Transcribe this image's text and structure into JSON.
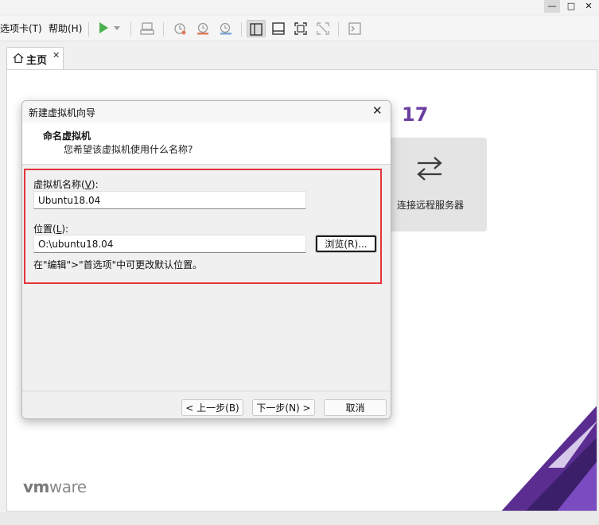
{
  "window": {
    "minimize": "—",
    "maximize": "□",
    "close": "✕"
  },
  "menu": {
    "tabs_label": "选项卡(T)",
    "help_label": "帮助(H)"
  },
  "tab": {
    "label": "主页"
  },
  "home": {
    "brand_suffix": "17",
    "remote_label": "连接远程服务器",
    "logo_vm": "vm",
    "logo_ware": "ware"
  },
  "dialog": {
    "title": "新建虚拟机向导",
    "header_title": "命名虚拟机",
    "header_subtitle": "您希望该虚拟机使用什么名称?",
    "name_label_prefix": "虚拟机名称(",
    "name_label_key": "V",
    "name_label_suffix": "):",
    "name_value": "Ubuntu18.04",
    "location_label_prefix": "位置(",
    "location_label_key": "L",
    "location_label_suffix": "):",
    "location_value": "O:\\ubuntu18.04",
    "browse_label": "浏览(R)...",
    "hint": "在\"编辑\">\"首选项\"中可更改默认位置。",
    "back_label": "< 上一步(B)",
    "next_label": "下一步(N) >",
    "cancel_label": "取消"
  },
  "colors": {
    "highlight": "#e2343a",
    "play": "#4caf50",
    "brand": "#6b3fa0",
    "deco_purple": "#5b2d91"
  },
  "icons": [
    "minimize-icon",
    "maximize-icon",
    "close-icon",
    "play-icon",
    "dropdown-icon",
    "send-keys-icon",
    "snapshot-icon",
    "revert-icon",
    "manage-snapshots-icon",
    "library-view-icon",
    "console-view-icon",
    "fullscreen-icon",
    "unity-icon",
    "terminal-icon",
    "home-icon",
    "swap-arrows-icon"
  ]
}
